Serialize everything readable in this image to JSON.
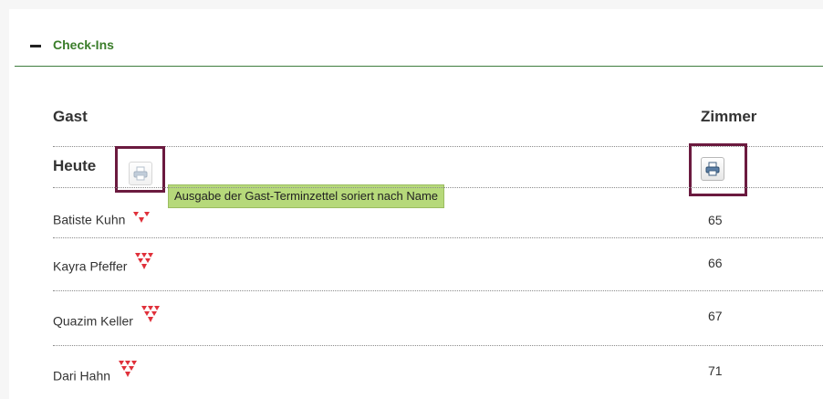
{
  "section": {
    "title": "Check-Ins"
  },
  "table": {
    "col_guest": "Gast",
    "col_room": "Zimmer",
    "group_label": "Heute",
    "tooltip": "Ausgabe der Gast-Terminzettel soriert nach Name",
    "rows": [
      {
        "guest": "Batiste Kuhn",
        "room": "65",
        "icon": "vip-triangles-icon"
      },
      {
        "guest": "Kayra Pfeffer",
        "room": "66",
        "icon": "vip-triangles-icon"
      },
      {
        "guest": "Quazim Keller",
        "room": "67",
        "icon": "vip-triangles-icon"
      },
      {
        "guest": "Dari Hahn",
        "room": "71",
        "icon": "vip-triangles-icon"
      }
    ]
  },
  "colors": {
    "accent_green": "#3a7d2a",
    "highlight_border": "#6b1a3f",
    "tooltip_bg": "#b6d97a",
    "vip_red": "#e0303a"
  }
}
